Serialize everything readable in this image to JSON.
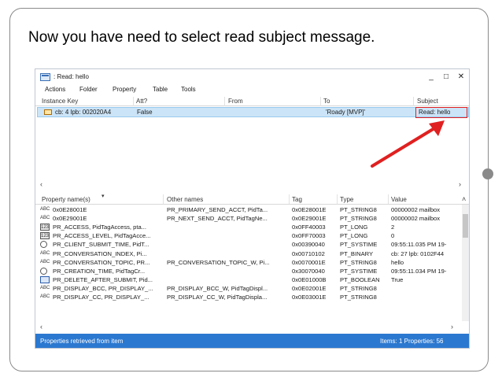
{
  "slide": {
    "instruction": "Now you have need to select read subject message."
  },
  "window": {
    "title": ": Read: hello",
    "controls": {
      "minimize": "_",
      "maximize": "□",
      "close": "✕"
    },
    "menu": [
      "Actions",
      "Folder",
      "Property",
      "Table",
      "Tools"
    ]
  },
  "upper_table": {
    "headers": [
      "Instance Key",
      "Att?",
      "From",
      "To",
      "Subject"
    ],
    "rows": [
      {
        "instance_key": "cb: 4 lpb: 002020A4",
        "att": "False",
        "from": "",
        "to": "'Roady [MVP]'",
        "subject": "Read: hello"
      }
    ]
  },
  "lower_table": {
    "headers": [
      "Property name(s)",
      "Other names",
      "Tag",
      "Type",
      "Value"
    ],
    "rows": [
      {
        "icon": "ABC",
        "name": "0x0E28001E",
        "other": "PR_PRIMARY_SEND_ACCT, PidTa...",
        "tag": "0x0E28001E",
        "type": "PT_STRING8",
        "value": "00000002  mailbox"
      },
      {
        "icon": "ABC",
        "name": "0x0E29001E",
        "other": "PR_NEXT_SEND_ACCT, PidTagNe...",
        "tag": "0x0E29001E",
        "type": "PT_STRING8",
        "value": "00000002  mailbox"
      },
      {
        "icon": "123",
        "name": "PR_ACCESS, PidTagAccess, pta...",
        "other": "",
        "tag": "0x0FF40003",
        "type": "PT_LONG",
        "value": "2"
      },
      {
        "icon": "123",
        "name": "PR_ACCESS_LEVEL, PidTagAcce...",
        "other": "",
        "tag": "0x0FF70003",
        "type": "PT_LONG",
        "value": "0"
      },
      {
        "icon": "clock",
        "name": "PR_CLIENT_SUBMIT_TIME, PidT...",
        "other": "",
        "tag": "0x00390040",
        "type": "PT_SYSTIME",
        "value": "09:55:11.035 PM 19-"
      },
      {
        "icon": "ABC",
        "name": "PR_CONVERSATION_INDEX, Pi...",
        "other": "",
        "tag": "0x00710102",
        "type": "PT_BINARY",
        "value": "cb: 27 lpb: 0102F44"
      },
      {
        "icon": "ABC",
        "name": "PR_CONVERSATION_TOPIC, PR...",
        "other": "PR_CONVERSATION_TOPIC_W, Pi...",
        "tag": "0x0070001E",
        "type": "PT_STRING8",
        "value": "hello"
      },
      {
        "icon": "clock",
        "name": "PR_CREATION_TIME, PidTagCr...",
        "other": "",
        "tag": "0x30070040",
        "type": "PT_SYSTIME",
        "value": "09:55:11.034 PM 19-"
      },
      {
        "icon": "bool",
        "name": "PR_DELETE_AFTER_SUBMIT, Pid...",
        "other": "",
        "tag": "0x0E01000B",
        "type": "PT_BOOLEAN",
        "value": "True"
      },
      {
        "icon": "ABC",
        "name": "PR_DISPLAY_BCC, PR_DISPLAY_...",
        "other": "PR_DISPLAY_BCC_W, PidTagDispl...",
        "tag": "0x0E02001E",
        "type": "PT_STRING8",
        "value": ""
      },
      {
        "icon": "ABC",
        "name": "PR_DISPLAY_CC, PR_DISPLAY_...",
        "other": "PR_DISPLAY_CC_W, PidTagDispla...",
        "tag": "0x0E03001E",
        "type": "PT_STRING8",
        "value": ""
      }
    ]
  },
  "status": {
    "left": "Properties retrieved from item",
    "right": "Items: 1  Properties: 56"
  },
  "colors": {
    "status_bar": "#2b78d0",
    "selection": "#cce4f7",
    "highlight": "#e02020",
    "arrow": "#e02020"
  }
}
